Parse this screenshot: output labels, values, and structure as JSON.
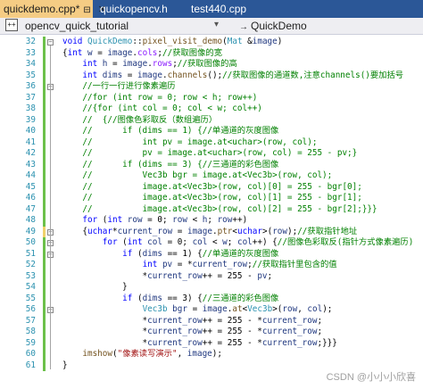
{
  "tabs": [
    {
      "label": "quickdemo.cpp*",
      "active": true,
      "close": "✕",
      "pin": "⊟"
    },
    {
      "label": "quickopencv.h",
      "active": false
    },
    {
      "label": "test440.cpp",
      "active": false
    }
  ],
  "navbar": {
    "project": "opencv_quick_tutorial",
    "scope_arrow": "→",
    "scope": "QuickDemo"
  },
  "code": {
    "lines": [
      {
        "n": "32",
        "tokens": [
          [
            "kw",
            "void "
          ],
          [
            "ty",
            "QuickDemo"
          ],
          [
            "op",
            "::"
          ],
          [
            "fn",
            "pixel_visit_demo"
          ],
          [
            "op",
            "("
          ],
          [
            "ty",
            "Mat"
          ],
          [
            "op",
            " &"
          ],
          [
            "va",
            "image"
          ],
          [
            "op",
            ")"
          ]
        ]
      },
      {
        "n": "33",
        "tokens": [
          [
            "op",
            "{"
          ],
          [
            "kw",
            "int "
          ],
          [
            "va",
            "w"
          ],
          [
            "op",
            " = "
          ],
          [
            "va",
            "image"
          ],
          [
            "op",
            "."
          ],
          [
            "mb",
            "cols"
          ],
          [
            "op",
            ";"
          ],
          [
            "cm",
            "//获取图像的宽"
          ]
        ]
      },
      {
        "n": "34",
        "tokens": [
          [
            "op",
            "    "
          ],
          [
            "kw",
            "int "
          ],
          [
            "va",
            "h"
          ],
          [
            "op",
            " = "
          ],
          [
            "va",
            "image"
          ],
          [
            "op",
            "."
          ],
          [
            "mb",
            "rows"
          ],
          [
            "op",
            ";"
          ],
          [
            "cm",
            "//获取图像的高"
          ]
        ]
      },
      {
        "n": "35",
        "tokens": [
          [
            "op",
            "    "
          ],
          [
            "kw",
            "int "
          ],
          [
            "va",
            "dims"
          ],
          [
            "op",
            " = "
          ],
          [
            "va",
            "image"
          ],
          [
            "op",
            "."
          ],
          [
            "fn",
            "channels"
          ],
          [
            "op",
            "();"
          ],
          [
            "cm",
            "//获取图像的通道数,注意channels()要加括号"
          ]
        ]
      },
      {
        "n": "36",
        "tokens": [
          [
            "op",
            "    "
          ],
          [
            "cm",
            "//一行一行进行像素遍历"
          ]
        ]
      },
      {
        "n": "37",
        "tokens": [
          [
            "op",
            "    "
          ],
          [
            "cm",
            "//for (int row = 0; row < h; row++)"
          ]
        ]
      },
      {
        "n": "38",
        "tokens": [
          [
            "op",
            "    "
          ],
          [
            "cm",
            "//{for (int col = 0; col < w; col++)"
          ]
        ]
      },
      {
        "n": "39",
        "tokens": [
          [
            "op",
            "    "
          ],
          [
            "cm",
            "//  {//图像色彩取反（数组遍历）"
          ]
        ]
      },
      {
        "n": "40",
        "tokens": [
          [
            "op",
            "    "
          ],
          [
            "cm",
            "//      if (dims == 1) {//单通道的灰度图像"
          ]
        ]
      },
      {
        "n": "41",
        "tokens": [
          [
            "op",
            "    "
          ],
          [
            "cm",
            "//          int pv = image.at<uchar>(row, col);"
          ]
        ]
      },
      {
        "n": "42",
        "tokens": [
          [
            "op",
            "    "
          ],
          [
            "cm",
            "//          pv = image.at<uchar>(row, col) = 255 - pv;}"
          ]
        ]
      },
      {
        "n": "43",
        "tokens": [
          [
            "op",
            "    "
          ],
          [
            "cm",
            "//      if (dims == 3) {//三通道的彩色图像"
          ]
        ]
      },
      {
        "n": "44",
        "tokens": [
          [
            "op",
            "    "
          ],
          [
            "cm",
            "//          Vec3b bgr = image.at<Vec3b>(row, col);"
          ]
        ]
      },
      {
        "n": "45",
        "tokens": [
          [
            "op",
            "    "
          ],
          [
            "cm",
            "//          image.at<Vec3b>(row, col)[0] = 255 - bgr[0];"
          ]
        ]
      },
      {
        "n": "46",
        "tokens": [
          [
            "op",
            "    "
          ],
          [
            "cm",
            "//          image.at<Vec3b>(row, col)[1] = 255 - bgr[1];"
          ]
        ]
      },
      {
        "n": "47",
        "tokens": [
          [
            "op",
            "    "
          ],
          [
            "cm",
            "//          image.at<Vec3b>(row, col)[2] = 255 - bgr[2];}}}"
          ]
        ]
      },
      {
        "n": "48",
        "tokens": [
          [
            "op",
            "    "
          ],
          [
            "kw",
            "for "
          ],
          [
            "op",
            "("
          ],
          [
            "kw",
            "int "
          ],
          [
            "va",
            "row"
          ],
          [
            "op",
            " = 0; "
          ],
          [
            "va",
            "row"
          ],
          [
            "op",
            " < "
          ],
          [
            "va",
            "h"
          ],
          [
            "op",
            "; "
          ],
          [
            "va",
            "row"
          ],
          [
            "op",
            "++)"
          ]
        ]
      },
      {
        "n": "49",
        "tokens": [
          [
            "op",
            "    {"
          ],
          [
            "kw",
            "uchar"
          ],
          [
            "op",
            "*"
          ],
          [
            "va",
            "current_row"
          ],
          [
            "op",
            " = "
          ],
          [
            "va",
            "image"
          ],
          [
            "op",
            "."
          ],
          [
            "fn",
            "ptr"
          ],
          [
            "op",
            "<"
          ],
          [
            "kw",
            "uchar"
          ],
          [
            "op",
            ">("
          ],
          [
            "va",
            "row"
          ],
          [
            "op",
            ");"
          ],
          [
            "cm",
            "//获取指针地址"
          ]
        ]
      },
      {
        "n": "50",
        "tokens": [
          [
            "op",
            "        "
          ],
          [
            "kw",
            "for "
          ],
          [
            "op",
            "("
          ],
          [
            "kw",
            "int "
          ],
          [
            "va",
            "col"
          ],
          [
            "op",
            " = 0; "
          ],
          [
            "va",
            "col"
          ],
          [
            "op",
            " < "
          ],
          [
            "va",
            "w"
          ],
          [
            "op",
            "; "
          ],
          [
            "va",
            "col"
          ],
          [
            "op",
            "++) {"
          ],
          [
            "cm",
            "//图像色彩取反(指针方式像素遍历)"
          ]
        ]
      },
      {
        "n": "51",
        "tokens": [
          [
            "op",
            "            "
          ],
          [
            "kw",
            "if "
          ],
          [
            "op",
            "("
          ],
          [
            "va",
            "dims"
          ],
          [
            "op",
            " == 1) {"
          ],
          [
            "cm",
            "//单通道的灰度图像"
          ]
        ]
      },
      {
        "n": "52",
        "tokens": [
          [
            "op",
            "                "
          ],
          [
            "kw",
            "int "
          ],
          [
            "va",
            "pv"
          ],
          [
            "op",
            " = *"
          ],
          [
            "va",
            "current_row"
          ],
          [
            "op",
            ";"
          ],
          [
            "cm",
            "//获取指针里包含的值"
          ]
        ]
      },
      {
        "n": "53",
        "tokens": [
          [
            "op",
            "                *"
          ],
          [
            "va",
            "current_row"
          ],
          [
            "op",
            "++ = 255 - "
          ],
          [
            "va",
            "pv"
          ],
          [
            "op",
            ";"
          ]
        ]
      },
      {
        "n": "54",
        "tokens": [
          [
            "op",
            "            }"
          ]
        ]
      },
      {
        "n": "55",
        "tokens": [
          [
            "op",
            "            "
          ],
          [
            "kw",
            "if "
          ],
          [
            "op",
            "("
          ],
          [
            "va",
            "dims"
          ],
          [
            "op",
            " == 3) {"
          ],
          [
            "cm",
            "//三通道的彩色图像"
          ]
        ]
      },
      {
        "n": "56",
        "tokens": [
          [
            "op",
            "                "
          ],
          [
            "ty",
            "Vec3b"
          ],
          [
            "op",
            " "
          ],
          [
            "va",
            "bgr"
          ],
          [
            "op",
            " = "
          ],
          [
            "va",
            "image"
          ],
          [
            "op",
            "."
          ],
          [
            "fn",
            "at"
          ],
          [
            "op",
            "<"
          ],
          [
            "ty",
            "Vec3b"
          ],
          [
            "op",
            ">("
          ],
          [
            "va",
            "row"
          ],
          [
            "op",
            ", "
          ],
          [
            "va",
            "col"
          ],
          [
            "op",
            ");"
          ]
        ]
      },
      {
        "n": "57",
        "tokens": [
          [
            "op",
            "                *"
          ],
          [
            "va",
            "current_row"
          ],
          [
            "op",
            "++ = 255 - *"
          ],
          [
            "va",
            "current_row"
          ],
          [
            "op",
            ";"
          ]
        ]
      },
      {
        "n": "58",
        "tokens": [
          [
            "op",
            "                *"
          ],
          [
            "va",
            "current_row"
          ],
          [
            "op",
            "++ = 255 - *"
          ],
          [
            "va",
            "current_row"
          ],
          [
            "op",
            ";"
          ]
        ]
      },
      {
        "n": "59",
        "tokens": [
          [
            "op",
            "                *"
          ],
          [
            "va",
            "current_row"
          ],
          [
            "op",
            "++ = 255 - *"
          ],
          [
            "va",
            "current_row"
          ],
          [
            "op",
            ";}}}"
          ]
        ]
      },
      {
        "n": "60",
        "tokens": [
          [
            "op",
            "    "
          ],
          [
            "fn",
            "imshow"
          ],
          [
            "op",
            "("
          ],
          [
            "st",
            "\"像素读写演示\""
          ],
          [
            "op",
            ", "
          ],
          [
            "va",
            "image"
          ],
          [
            "op",
            ");"
          ]
        ]
      },
      {
        "n": "61",
        "tokens": [
          [
            "op",
            "}"
          ]
        ]
      }
    ]
  },
  "watermark": "CSDN @小小小欣喜",
  "colors": {
    "tab_bar": "#2b5797",
    "active_tab": "#f5cc84",
    "keyword": "#0000ff",
    "comment": "#008000",
    "type": "#2b91af",
    "string": "#a31515",
    "line_number": "#2b91af",
    "change_saved": "#6cc04a",
    "change_unsaved": "#f0d26b"
  }
}
